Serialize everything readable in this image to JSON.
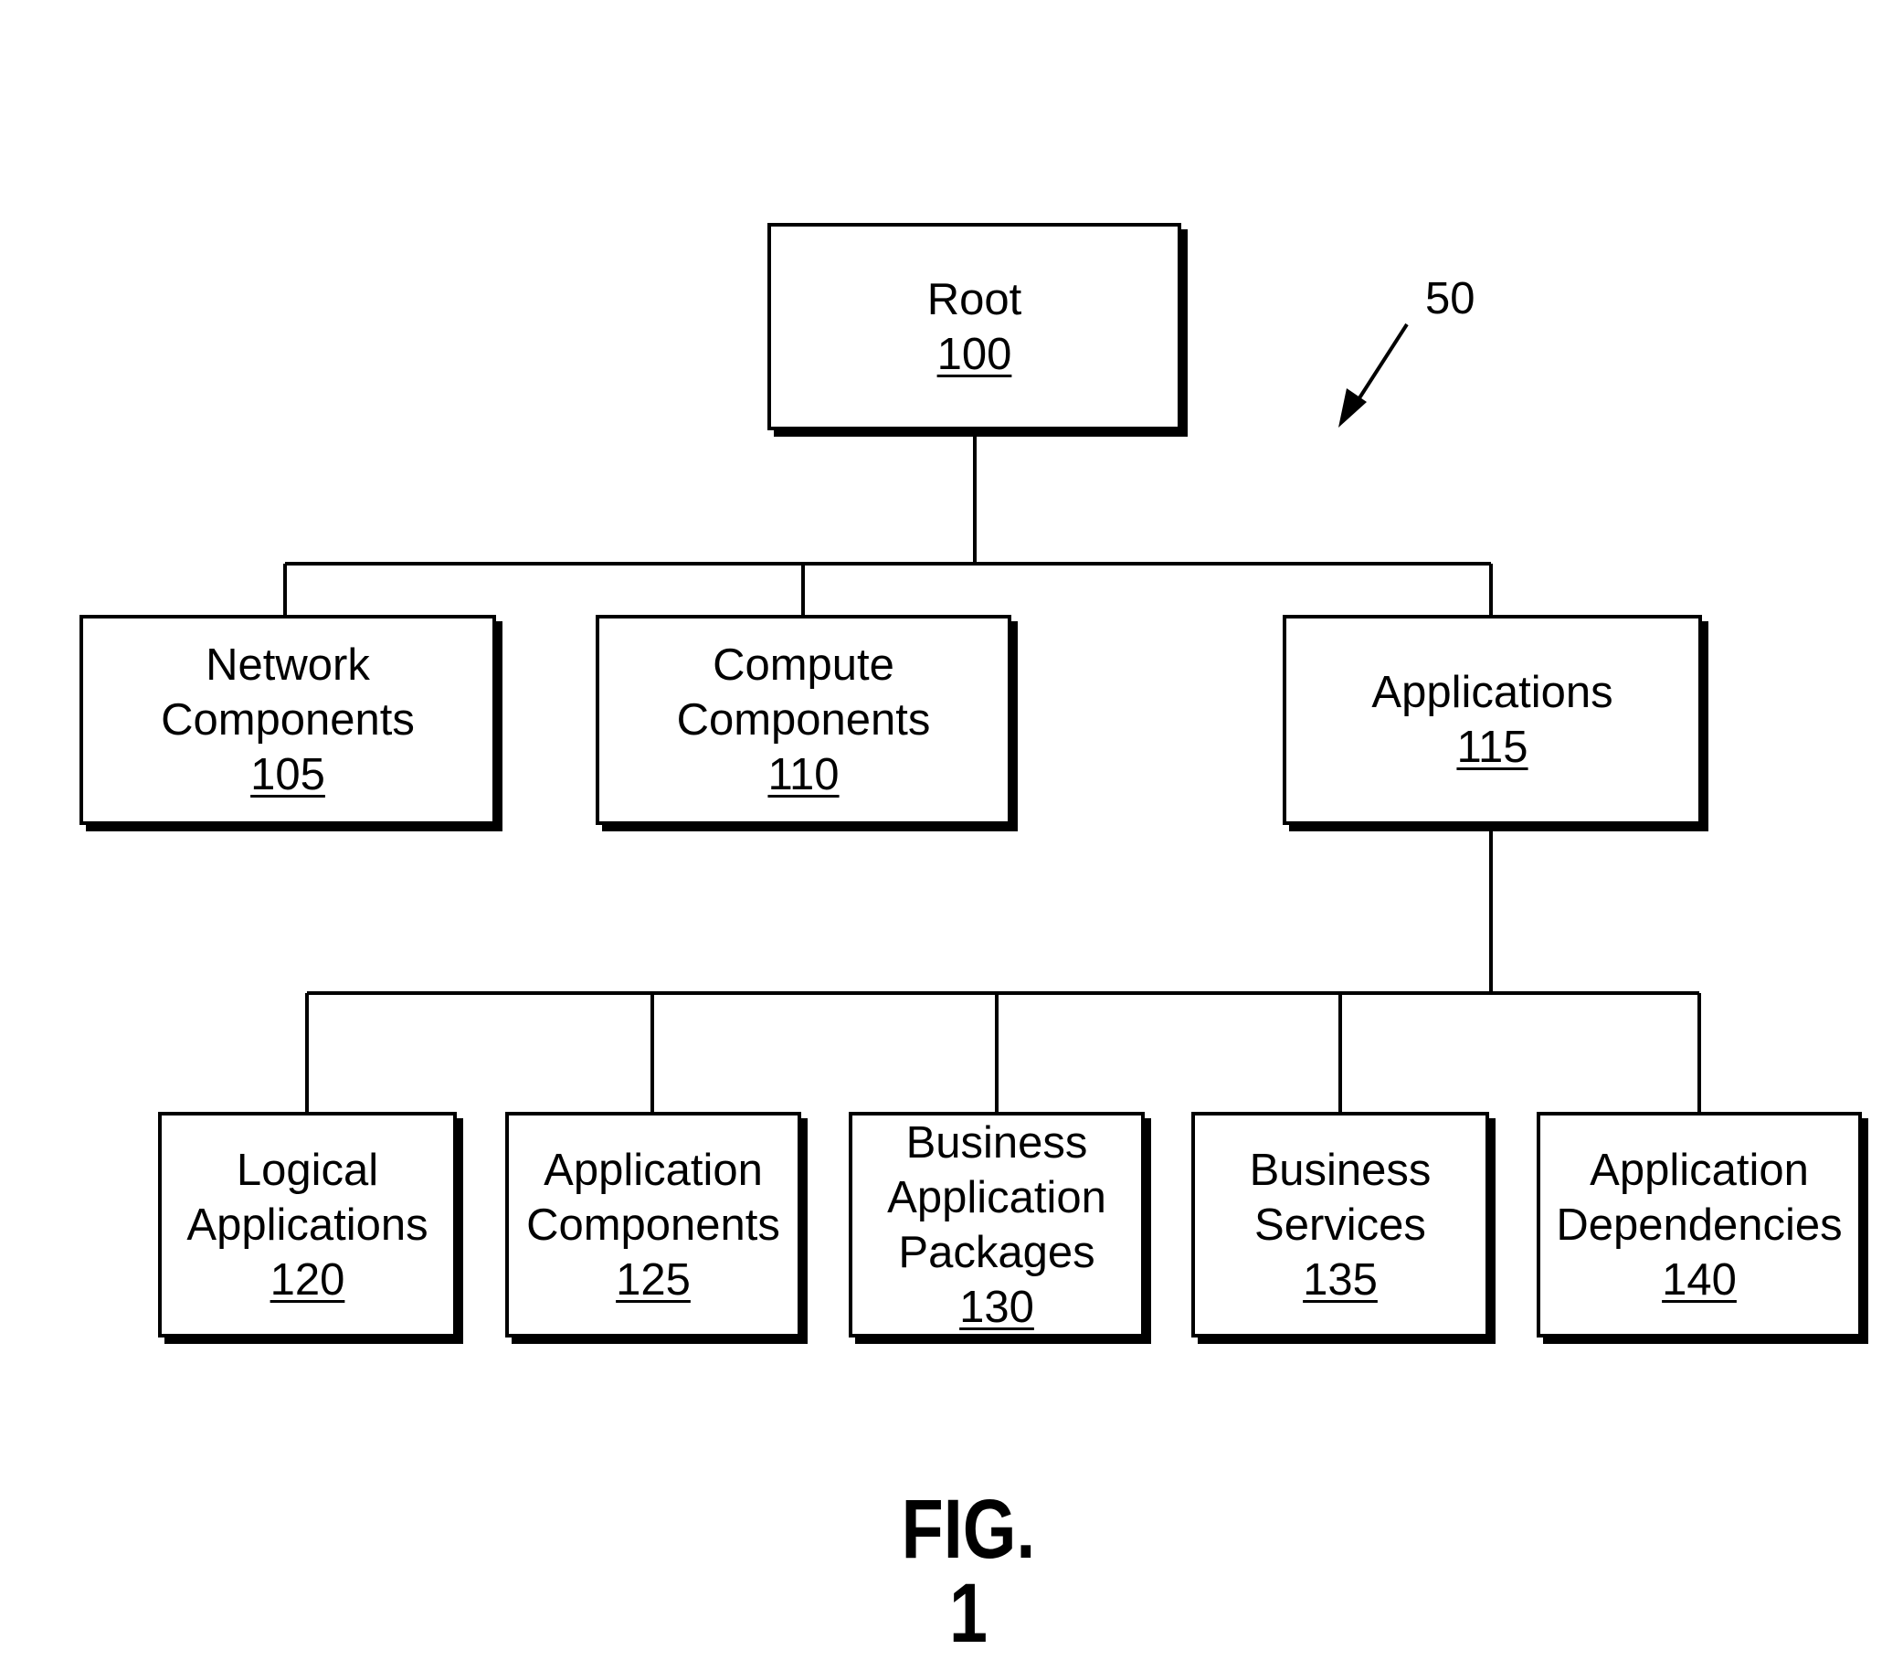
{
  "figure": {
    "label": "FIG. 1",
    "reference_numeral": "50",
    "colors": {
      "ink": "#000000",
      "background": "#ffffff"
    }
  },
  "nodes": {
    "root": {
      "lines": [
        "Root"
      ],
      "ref": "100"
    },
    "network": {
      "lines": [
        "Network",
        "Components"
      ],
      "ref": "105"
    },
    "compute": {
      "lines": [
        "Compute",
        "Components"
      ],
      "ref": "110"
    },
    "applications": {
      "lines": [
        "Applications"
      ],
      "ref": "115"
    },
    "logical": {
      "lines": [
        "Logical",
        "Applications"
      ],
      "ref": "120"
    },
    "app_components": {
      "lines": [
        "Application",
        "Components"
      ],
      "ref": "125"
    },
    "packages": {
      "lines": [
        "Business",
        "Application",
        "Packages"
      ],
      "ref": "130"
    },
    "services": {
      "lines": [
        "Business",
        "Services"
      ],
      "ref": "135"
    },
    "dependencies": {
      "lines": [
        "Application",
        "Dependencies"
      ],
      "ref": "140"
    }
  },
  "edges": [
    [
      "root",
      "network"
    ],
    [
      "root",
      "compute"
    ],
    [
      "root",
      "applications"
    ],
    [
      "applications",
      "logical"
    ],
    [
      "applications",
      "app_components"
    ],
    [
      "applications",
      "packages"
    ],
    [
      "applications",
      "services"
    ],
    [
      "applications",
      "dependencies"
    ]
  ]
}
